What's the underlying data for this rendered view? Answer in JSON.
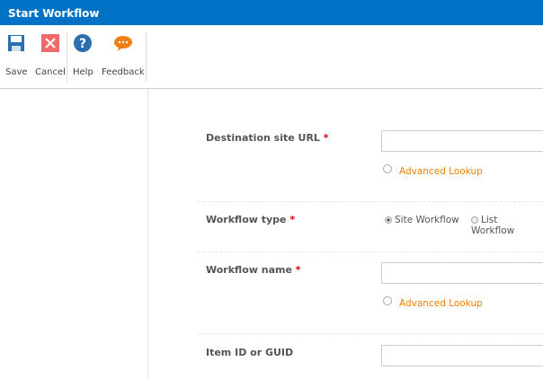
{
  "title": "Start Workflow",
  "toolbar": {
    "save": "Save",
    "cancel": "Cancel",
    "help": "Help",
    "feedback": "Feedback"
  },
  "form": {
    "destination_label": "Destination site URL",
    "required": "*",
    "advanced_lookup": "Advanced Lookup",
    "workflow_type_label": "Workflow type",
    "site_workflow": "Site Workflow",
    "list_workflow": "List Workflow",
    "workflow_name_label": "Workflow name",
    "item_id_label": "Item ID or GUID"
  }
}
